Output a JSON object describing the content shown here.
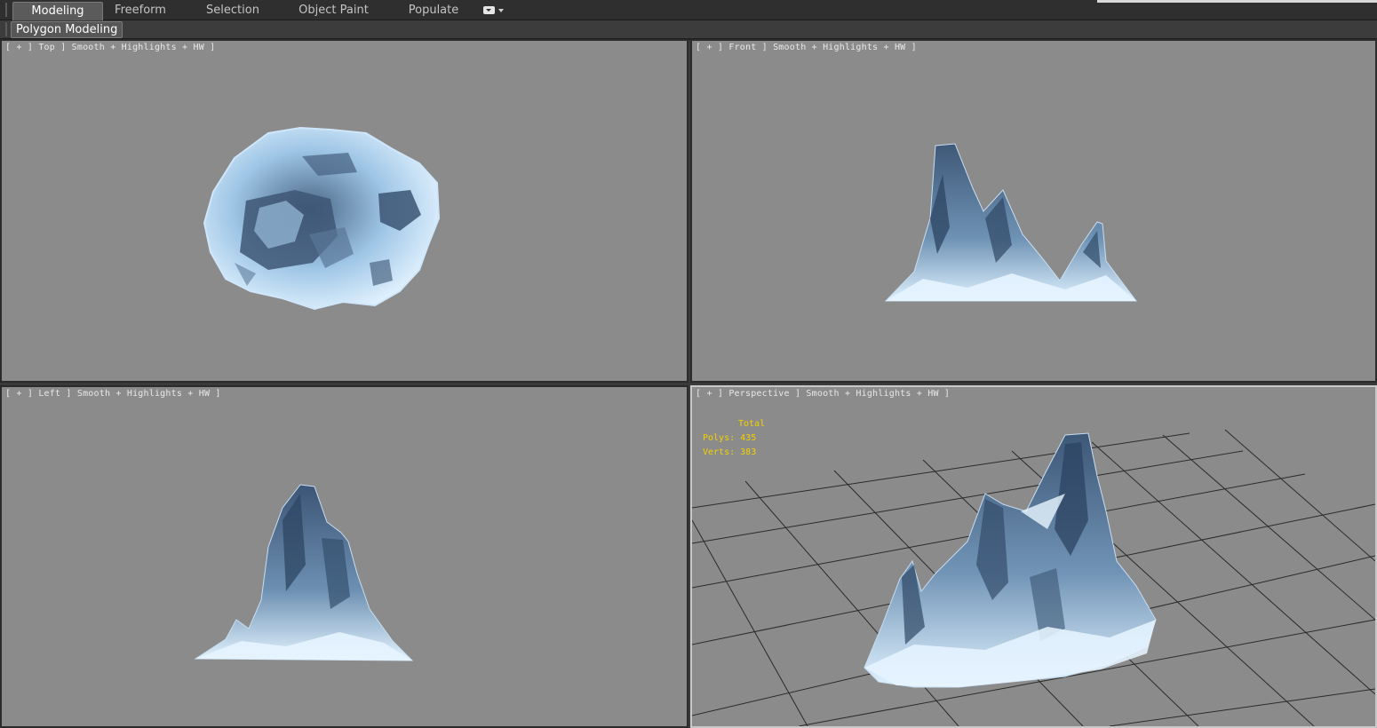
{
  "ribbon": {
    "tabs": [
      {
        "label": "Modeling",
        "active": true
      },
      {
        "label": "Freeform",
        "active": false
      },
      {
        "label": "Selection",
        "active": false
      },
      {
        "label": "Object Paint",
        "active": false
      },
      {
        "label": "Populate",
        "active": false
      }
    ],
    "options_icon": "toggle-pill-icon",
    "panel_label": "Polygon Modeling"
  },
  "viewports": {
    "top": {
      "label": "[ + ] Top ] Smooth + Highlights + HW ]"
    },
    "front": {
      "label": "[ + ] Front ] Smooth + Highlights + HW ]"
    },
    "left": {
      "label": "[ + ] Left ] Smooth + Highlights + HW ]"
    },
    "perspective": {
      "label": "[ + ] Perspective ] Smooth + Highlights + HW ]"
    }
  },
  "stats": {
    "title": "Total",
    "polys_label": "Polys:",
    "polys_value": "435",
    "verts_label": "Verts:",
    "verts_value": "383"
  },
  "colors": {
    "viewport_bg": "#8b8b8b",
    "stats_text": "#f2d100",
    "snow": "#dbeefb",
    "ice_dark": "#4b6585",
    "grid_line": "#2a2a2a"
  }
}
